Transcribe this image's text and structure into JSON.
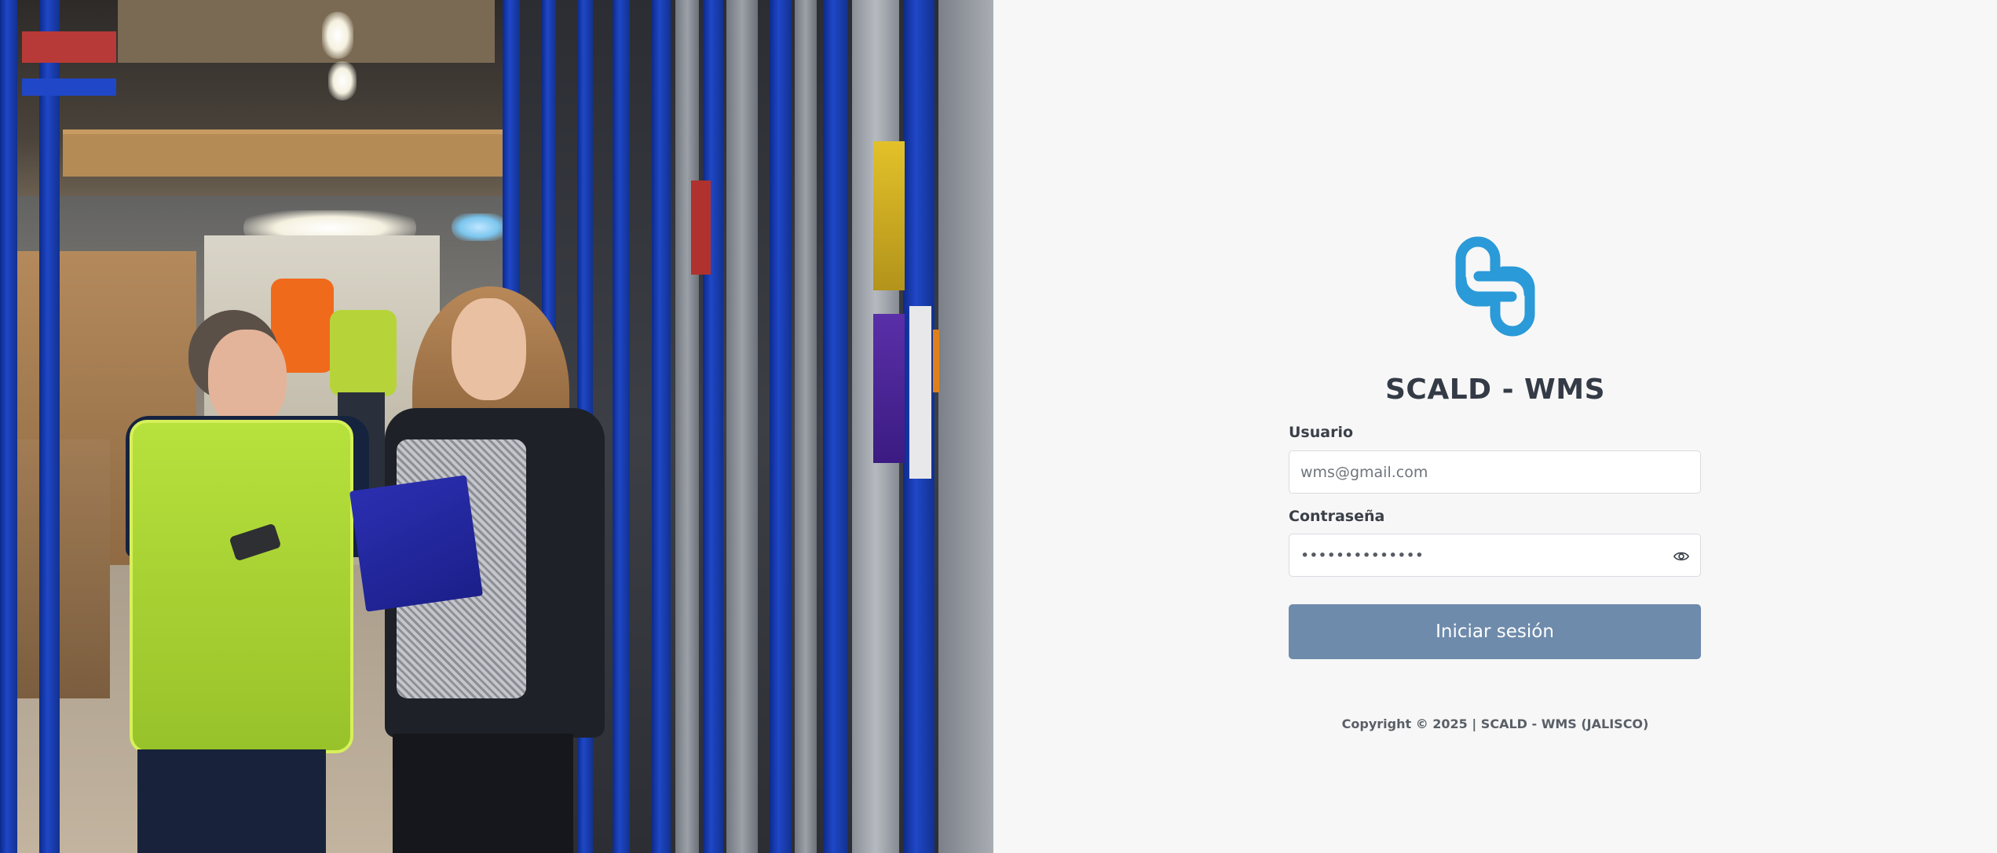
{
  "hero": {
    "description_icon": "warehouse-photo"
  },
  "brand": {
    "title": "SCALD - WMS",
    "logo_icon": "scald-logo-icon",
    "accent_color": "#2a9ad8"
  },
  "form": {
    "username": {
      "label": "Usuario",
      "value": "",
      "placeholder": "wms@gmail.com"
    },
    "password": {
      "label": "Contraseña",
      "value": "**************",
      "placeholder": "",
      "toggle_icon": "eye-icon"
    },
    "submit_label": "Iniciar sesión",
    "submit_color": "#6e8bab"
  },
  "footer": {
    "copyright": "Copyright © 2025 | SCALD - WMS (JALISCO)"
  }
}
